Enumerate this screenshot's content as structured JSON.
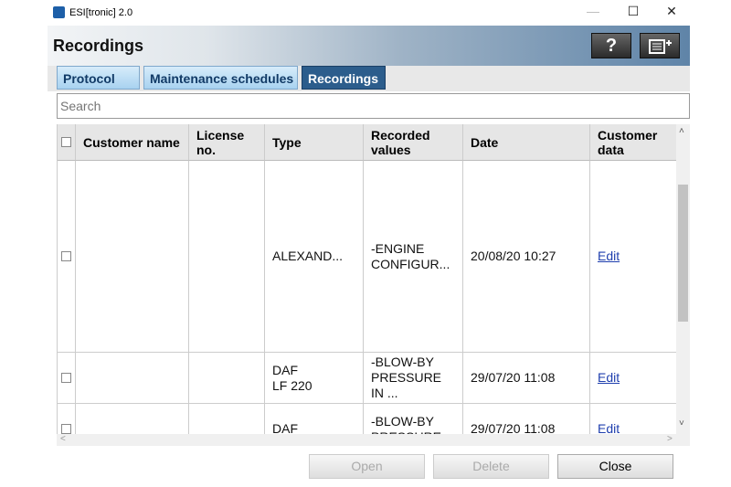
{
  "window": {
    "title": "ESI[tronic] 2.0",
    "minimize": "—",
    "maximize": "☐",
    "close": "✕"
  },
  "header": {
    "title": "Recordings",
    "help_label": "?",
    "menu_icon": "list-export-icon"
  },
  "tabs": [
    {
      "label": "Protocol"
    },
    {
      "label": "Maintenance schedules"
    },
    {
      "label": "Recordings",
      "active": true
    }
  ],
  "search": {
    "placeholder": "Search",
    "value": ""
  },
  "table": {
    "columns": [
      "Customer name",
      "License no.",
      "Type",
      "Recorded values",
      "Date",
      "Customer data"
    ],
    "rows": [
      {
        "customer": "",
        "license": "",
        "type": "ALEXAND...",
        "recorded": "-ENGINE CONFIGUR...",
        "date": "20/08/20 10:27",
        "action": "Edit"
      },
      {
        "customer": "",
        "license": "",
        "type": "DAF\nLF 220",
        "recorded": "-BLOW-BY PRESSURE IN ...",
        "date": "29/07/20 11:08",
        "action": "Edit"
      },
      {
        "customer": "",
        "license": "",
        "type": "DAF",
        "recorded": "-BLOW-BY PRESSURE",
        "date": "29/07/20 11:08",
        "action": "Edit"
      }
    ]
  },
  "buttons": {
    "open": "Open",
    "delete": "Delete",
    "close": "Close"
  }
}
